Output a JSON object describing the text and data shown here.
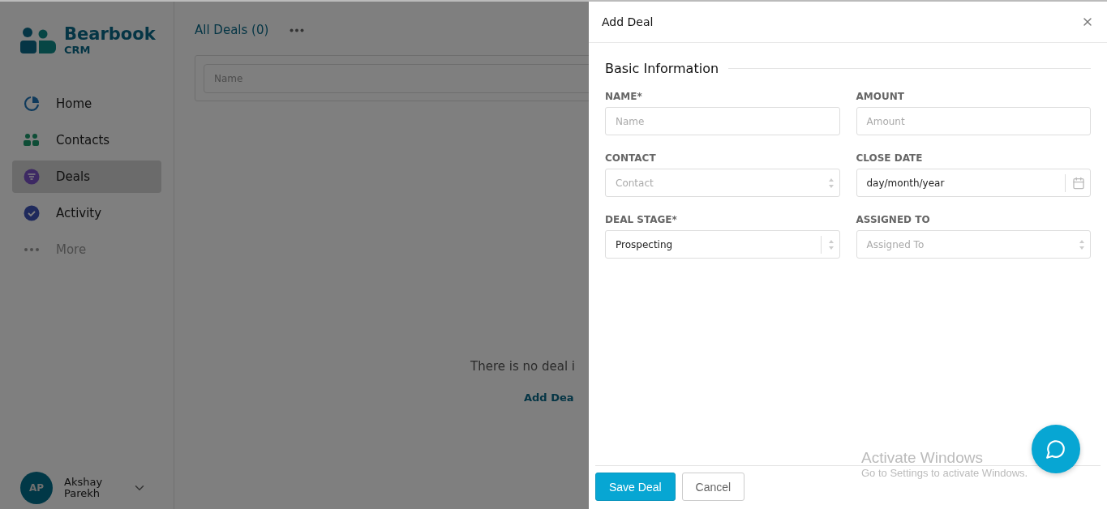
{
  "brand": {
    "name": "Bearbook",
    "sub": "CRM"
  },
  "sidebar": {
    "items": [
      {
        "label": "Home",
        "selected": false
      },
      {
        "label": "Contacts",
        "selected": false
      },
      {
        "label": "Deals",
        "selected": true
      },
      {
        "label": "Activity",
        "selected": false
      },
      {
        "label": "More",
        "selected": false
      }
    ],
    "user": {
      "initials": "AP",
      "name": "Akshay Parekh"
    }
  },
  "main": {
    "title": "All Deals (0)",
    "filter_placeholder": "Name",
    "empty_text": "There is no deal i",
    "empty_link": "Add Dea"
  },
  "drawer": {
    "title": "Add Deal",
    "section": "Basic Information",
    "fields": [
      {
        "label": "NAME*",
        "kind": "text",
        "placeholder": "Name"
      },
      {
        "label": "AMOUNT",
        "kind": "text",
        "placeholder": "Amount"
      },
      {
        "label": "CONTACT",
        "kind": "select",
        "placeholder": "Contact"
      },
      {
        "label": "CLOSE DATE",
        "kind": "date",
        "value": "day/month/year"
      },
      {
        "label": "DEAL STAGE*",
        "kind": "select",
        "value": "Prospecting"
      },
      {
        "label": "ASSIGNED TO",
        "kind": "select",
        "placeholder": "Assigned To"
      }
    ],
    "buttons": [
      "Save Deal",
      "Cancel"
    ]
  },
  "os_notice": {
    "title": "Activate Windows",
    "text": "Go to Settings to activate Windows."
  }
}
